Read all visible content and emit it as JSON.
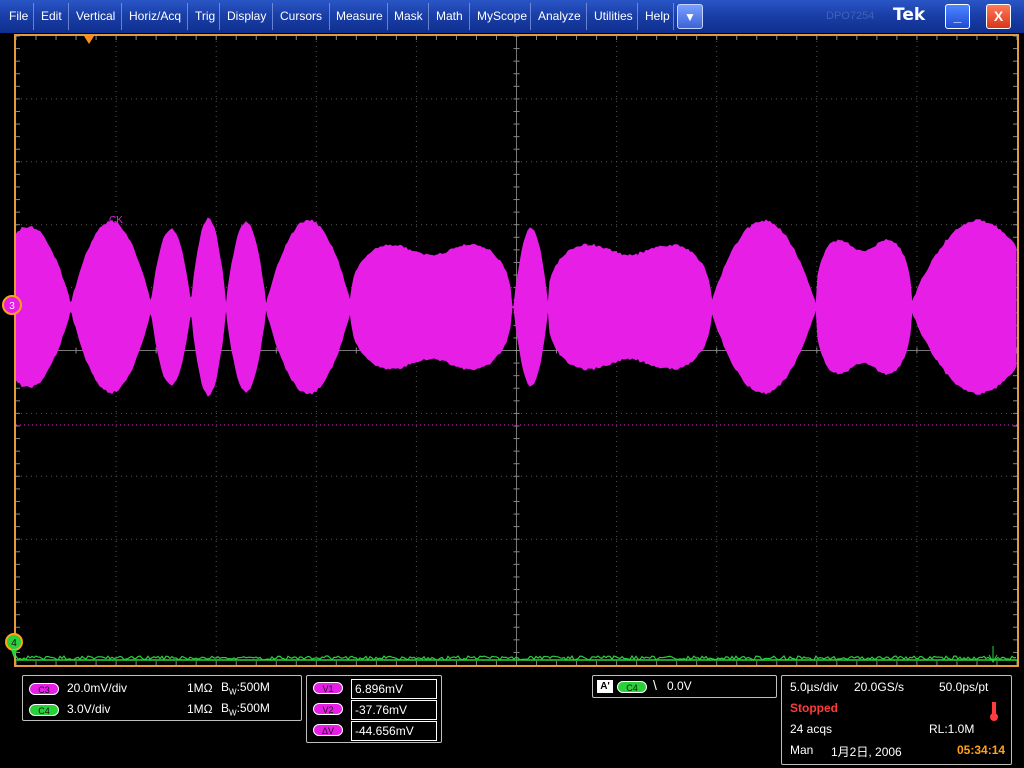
{
  "menu": {
    "items": [
      "File",
      "Edit",
      "Vertical",
      "Horiz/Acq",
      "Trig",
      "Display",
      "Cursors",
      "Measure",
      "Mask",
      "Math",
      "MyScope",
      "Analyze",
      "Utilities",
      "Help"
    ],
    "dropdown_glyph": "▼",
    "faint_label": "DPO7254",
    "brand": "Tek",
    "minimize_glyph": "_",
    "close_glyph": "X"
  },
  "scope": {
    "waveform_label": "CK",
    "ch3_marker": "3",
    "ch4_marker": "4",
    "colors": {
      "ch3": "#e61ee6",
      "ch4": "#29d03a",
      "border": "#e49b3a",
      "trigger": "#ff8c1a"
    }
  },
  "channels": [
    {
      "id": "C3",
      "scale": "20.0mV/div",
      "impedance": "1MΩ",
      "bw_label": "B",
      "bw_sub": "W",
      "bw": ":500M"
    },
    {
      "id": "C4",
      "scale": "3.0V/div",
      "impedance": "1MΩ",
      "bw_label": "B",
      "bw_sub": "W",
      "bw": ":500M"
    }
  ],
  "cursors": [
    {
      "label": "V1",
      "value": "6.896mV"
    },
    {
      "label": "V2",
      "value": "-37.76mV"
    },
    {
      "label": "ΔV",
      "value": "-44.656mV"
    }
  ],
  "trigger": {
    "mode": "A'",
    "source": "C4",
    "slope_glyph": "\\",
    "level": "0.0V"
  },
  "acquisition": {
    "time_div": "5.0µs/div",
    "sample_rate": "20.0GS/s",
    "resolution": "50.0ps/pt",
    "status": "Stopped",
    "acqs": "24 acqs",
    "record_length": "RL:1.0M",
    "mode": "Man",
    "date": "1月2日, 2006",
    "time": "05:34:14"
  }
}
